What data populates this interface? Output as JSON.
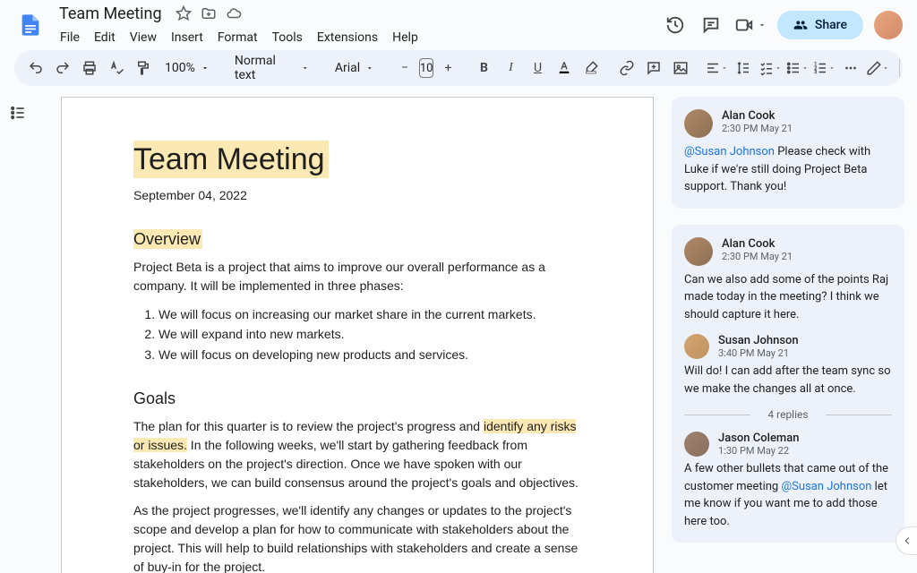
{
  "doc": {
    "title": "Team Meeting"
  },
  "menus": [
    "File",
    "Edit",
    "View",
    "Insert",
    "Format",
    "Tools",
    "Extensions",
    "Help"
  ],
  "toolbar": {
    "zoom": "100%",
    "style": "Normal text",
    "font": "Arial",
    "font_size": "10"
  },
  "share_label": "Share",
  "document": {
    "h1": "Team Meeting",
    "date": "September 04, 2022",
    "overview_h": "Overview",
    "overview_p": "Project Beta is a project that aims to improve our overall performance as a company. It will be implemented in three phases:",
    "list": [
      "We will focus on increasing our market share in the current markets.",
      "We will expand into new markets.",
      "We will focus on developing new products and services."
    ],
    "goals_h": "Goals",
    "goals_p1_a": "The plan for this quarter is to review the project's progress and ",
    "goals_p1_hl": "identify any risks or issues.",
    "goals_p1_b": " In the following weeks, we'll start by gathering feedback from stakeholders on the project's direction. Once we have spoken with our stakeholders, we can build consensus around the project's goals and objectives.",
    "goals_p2": "As the project progresses, we'll identify any changes or updates to the project's scope and develop a plan for how to communicate with stakeholders about the project. This will help to build relationships with stakeholders and create a sense of buy-in for the project."
  },
  "comments": [
    {
      "author": "Alan Cook",
      "time": "2:30 PM May 21",
      "mention": "@Susan Johnson",
      "text": " Please check with Luke if we're still doing Project Beta support. Thank you!",
      "avatar": "c-av1",
      "replies": []
    },
    {
      "author": "Alan Cook",
      "time": "2:30 PM May 21",
      "text": "Can we also add some of the points Raj made today in the meeting? I think we should capture it here.",
      "avatar": "c-av1",
      "replies": [
        {
          "author": "Susan Johnson",
          "time": "3:40 PM May 21",
          "text": "Will do! I can add after the team sync so we make the changes all at once.",
          "avatar": "c-av2"
        }
      ],
      "more_replies": "4 replies",
      "final_reply": {
        "author": "Jason Coleman",
        "time": "1:30 PM May 22",
        "text_a": "A few other bullets that came out of the customer meeting ",
        "mention": "@Susan Johnson",
        "text_b": " let me know if you want me to add those here too.",
        "avatar": "c-av3"
      }
    }
  ]
}
